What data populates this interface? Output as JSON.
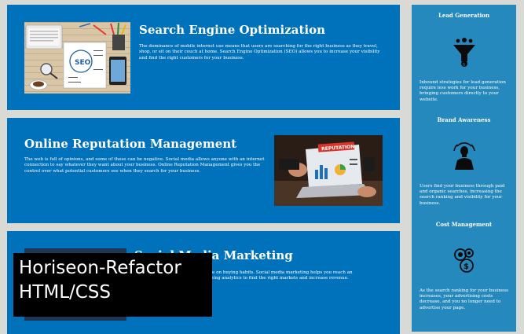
{
  "cards": [
    {
      "title": "Search Engine Optimization",
      "text": "The dominance of mobile internet use means that users are searching for the right business as they travel, shop, or sit on their couch at home. Search Engine Optimization (SEO) allows you to increase your visibility and find the right customers for your business."
    },
    {
      "title": "Online Reputation Management",
      "text": "The web is full of opinions, and some of these can be negative. Social media allows anyone with an internet connection to say whatever they want about your business. Online Reputation Management gives you the control over what potential customers see when they search for your business.",
      "photo_sign": "REPUTATION"
    },
    {
      "title": "Social Media Marketing",
      "text": "Social media has a sizable influence on buying habits. Social media marketing helps you reach an audience devoted to your brand, using analytics to find the right markets and increase revenue."
    }
  ],
  "sidebar": [
    {
      "title": "Lead Generation",
      "icon": "lead-generation-icon",
      "text": "Inbound strategies for lead generation require less work for your business, bringing customers directly to your website."
    },
    {
      "title": "Brand Awareness",
      "icon": "brand-awareness-icon",
      "text": "Users find your business through paid and organic searches, increasing the search ranking and visibility for your business."
    },
    {
      "title": "Cost Management",
      "icon": "cost-management-icon",
      "text": "As the search ranking for your business increases, your advertising costs decrease, and you no longer need to advertise your page."
    }
  ],
  "overlay": {
    "line1": "Horiseon-Refactor",
    "line2": "HTML/CSS"
  },
  "colors": {
    "card_blue": "#0072bb",
    "sidebar_blue": "#2589bd",
    "page_background": "#d9dad5"
  }
}
